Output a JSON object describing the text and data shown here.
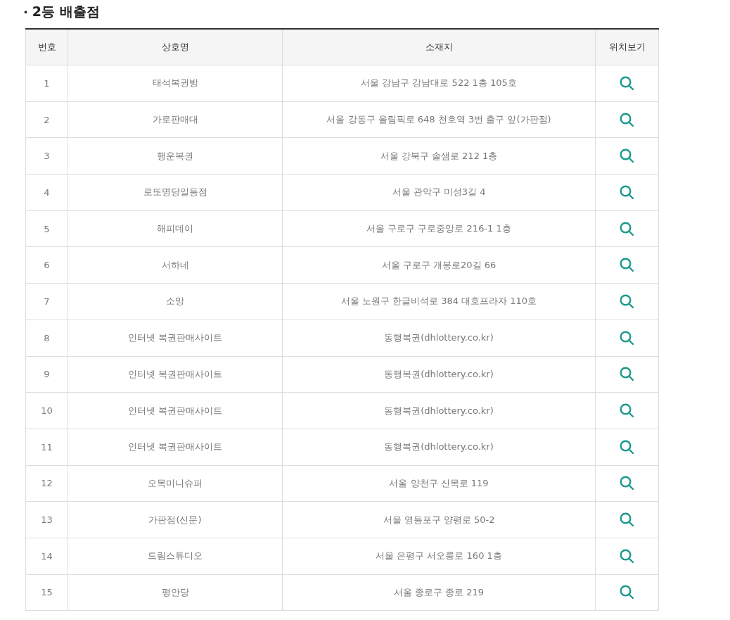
{
  "section": {
    "bullet": "·",
    "title": "2등 배출점"
  },
  "table": {
    "columns": [
      "번호",
      "상호명",
      "소재지",
      "위치보기"
    ],
    "rows": [
      {
        "no": "1",
        "name": "태석복권방",
        "address": "서울 강남구 강남대로 522 1층 105호"
      },
      {
        "no": "2",
        "name": "가로판매대",
        "address": "서울 강동구 올림픽로 648 천호역 3번 출구 앞(가판점)"
      },
      {
        "no": "3",
        "name": "행운복권",
        "address": "서울 강북구 솔샘로 212 1층"
      },
      {
        "no": "4",
        "name": "로또명당일등점",
        "address": "서울 관악구 미성3길 4"
      },
      {
        "no": "5",
        "name": "해피데이",
        "address": "서울 구로구 구로중앙로 216-1 1층"
      },
      {
        "no": "6",
        "name": "서하네",
        "address": "서울 구로구 개봉로20길 66"
      },
      {
        "no": "7",
        "name": "소망",
        "address": "서울 노원구 한글비석로 384 대호프라자 110호"
      },
      {
        "no": "8",
        "name": "인터넷 복권판매사이트",
        "address": "동행복권(dhlottery.co.kr)"
      },
      {
        "no": "9",
        "name": "인터넷 복권판매사이트",
        "address": "동행복권(dhlottery.co.kr)"
      },
      {
        "no": "10",
        "name": "인터넷 복권판매사이트",
        "address": "동행복권(dhlottery.co.kr)"
      },
      {
        "no": "11",
        "name": "인터넷 복권판매사이트",
        "address": "동행복권(dhlottery.co.kr)"
      },
      {
        "no": "12",
        "name": "오목미니슈퍼",
        "address": "서울 양천구 신목로 119"
      },
      {
        "no": "13",
        "name": "가판점(신문)",
        "address": "서울 영등포구 양평로 50-2"
      },
      {
        "no": "14",
        "name": "드림스튜디오",
        "address": "서울 은평구 서오릉로 160 1층"
      },
      {
        "no": "15",
        "name": "평안당",
        "address": "서울 종로구 종로 219"
      }
    ]
  }
}
